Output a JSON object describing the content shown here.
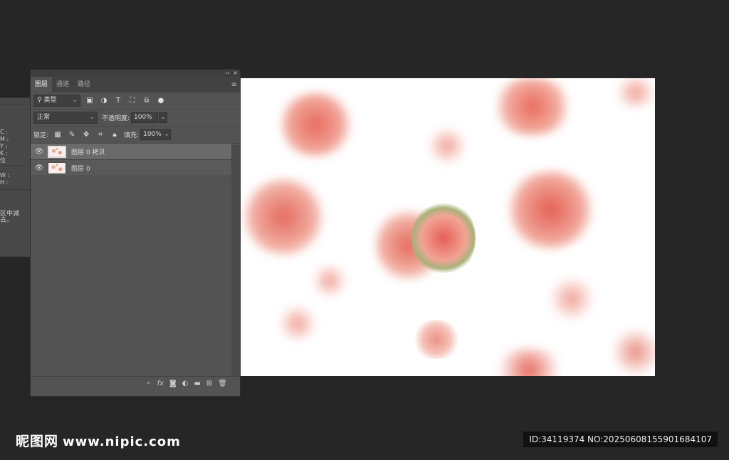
{
  "info_panel": {
    "labels": [
      "C :",
      "M :",
      "Y :",
      "K :",
      "位",
      "W :",
      "H :"
    ],
    "hint": "区中减去。"
  },
  "panel": {
    "collapse": "‹‹",
    "close": "×",
    "tabs": [
      "图层",
      "通道",
      "路径"
    ],
    "menu": "≡",
    "filter": {
      "value": "类型",
      "icons": [
        "image-filter-icon",
        "adjustment-filter-icon",
        "type-filter-icon",
        "shape-filter-icon",
        "smart-object-filter-icon",
        "filter-toggle-icon"
      ]
    },
    "blend_mode": "正常",
    "opacity_label": "不透明度:",
    "opacity": "100%",
    "lock_label": "锁定:",
    "fill_label": "填充:",
    "fill": "100%",
    "layers": [
      {
        "name": "图层 0 拷贝",
        "visible": true,
        "selected": true
      },
      {
        "name": "图层 0",
        "visible": true,
        "selected": false
      }
    ],
    "footer_icons": [
      "link-icon",
      "fx-icon",
      "mask-icon",
      "adjustment-icon",
      "folder-icon",
      "new-layer-icon",
      "trash-icon"
    ]
  },
  "watermark": {
    "logo": "昵图网",
    "url": "www.nipic.com",
    "id_text": "ID:34119374 NO:20250608155901684107"
  }
}
